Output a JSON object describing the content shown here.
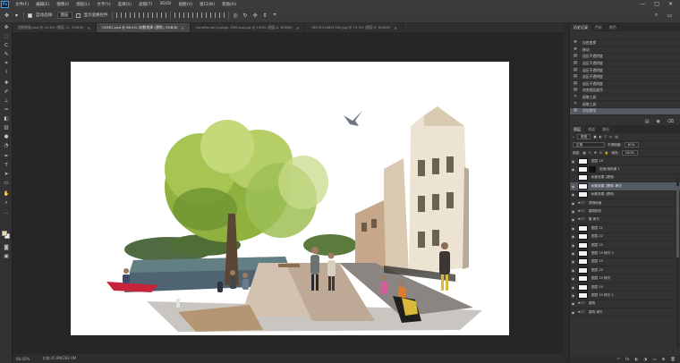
{
  "menubar": {
    "logo": "Ps",
    "items": [
      "文件(F)",
      "编辑(E)",
      "图像(I)",
      "图层(L)",
      "文字(Y)",
      "选择(S)",
      "滤镜(T)",
      "3D(D)",
      "视图(V)",
      "窗口(W)",
      "帮助(H)"
    ],
    "controls": [
      "—",
      "□",
      "✕"
    ]
  },
  "options": {
    "auto_select": "自动选择:",
    "target": "图层",
    "show_transform": "显示变换控件"
  },
  "tabs": [
    {
      "label": "透视拼贴.psd @ 20.6% (图层 12, RGB/8)",
      "active": false
    },
    {
      "label": "OVER1.psd @ 66.4% (树影效果 (透明), RGB/8)",
      "active": true
    },
    {
      "label": "LaneNursery.Lodge.-PMS-bar.jpg @ 100% (图层 0, RGB/8)",
      "active": false
    },
    {
      "label": "76078314851765.jpg @ 71.3% (图层 0, RGB/8)",
      "active": false
    }
  ],
  "status": {
    "zoom": "66.42%",
    "doc": "文档:45.8M/282.6M"
  },
  "history": {
    "tabs": [
      "历史记录",
      "色板",
      "颜色"
    ],
    "items": [
      {
        "icon": "✥",
        "label": "自由变换"
      },
      {
        "icon": "✥",
        "label": "移动"
      },
      {
        "icon": "▤",
        "label": "选区不透明度"
      },
      {
        "icon": "▤",
        "label": "选区不透明度"
      },
      {
        "icon": "▤",
        "label": "选区不透明度"
      },
      {
        "icon": "▤",
        "label": "选区不透明度"
      },
      {
        "icon": "▤",
        "label": "选区不透明度"
      },
      {
        "icon": "▤",
        "label": "改变图层顺序"
      },
      {
        "icon": "✎",
        "label": "画笔工具"
      },
      {
        "icon": "✎",
        "label": "画笔工具"
      },
      {
        "icon": "▤",
        "label": "添加蒙版"
      }
    ]
  },
  "layers": {
    "tabs": [
      "图层",
      "通道",
      "路径"
    ],
    "kind": "类型",
    "blend": "正常",
    "opacity_label": "不透明度:",
    "opacity": "61%",
    "lock_label": "锁定:",
    "fill_label": "填充:",
    "fill": "100%",
    "rows": [
      {
        "type": "layer",
        "name": "图层 18",
        "visible": true,
        "selected": false
      },
      {
        "type": "mask",
        "name": "色相/饱和度 1",
        "visible": true,
        "selected": false
      },
      {
        "type": "layer",
        "name": "树影效果 (透明)",
        "visible": false,
        "selected": false
      },
      {
        "type": "layer",
        "name": "树影效果 (透明) 拷贝",
        "visible": true,
        "selected": true
      },
      {
        "type": "layer",
        "name": "树影效果 (透明)",
        "visible": true,
        "selected": false
      },
      {
        "type": "folder",
        "name": "透视地面",
        "visible": true,
        "selected": false
      },
      {
        "type": "folder",
        "name": "建筑配件",
        "visible": true,
        "selected": false
      },
      {
        "type": "folder",
        "name": "集 拷贝",
        "visible": true,
        "selected": false
      },
      {
        "type": "layer",
        "name": "图层 21",
        "visible": true,
        "selected": false
      },
      {
        "type": "layer",
        "name": "图层 22",
        "visible": true,
        "selected": false
      },
      {
        "type": "layer",
        "name": "图层 23",
        "visible": true,
        "selected": false
      },
      {
        "type": "layer",
        "name": "图层 19 拷贝 3",
        "visible": true,
        "selected": false
      },
      {
        "type": "layer",
        "name": "图层 19",
        "visible": true,
        "selected": false
      },
      {
        "type": "layer",
        "name": "图层 20",
        "visible": true,
        "selected": false
      },
      {
        "type": "layer",
        "name": "图层 19 拷贝",
        "visible": true,
        "selected": false
      },
      {
        "type": "layer",
        "name": "图层 24",
        "visible": true,
        "selected": false
      },
      {
        "type": "layer",
        "name": "图层 19 拷贝 2",
        "visible": true,
        "selected": false
      },
      {
        "type": "folder",
        "name": "建筑",
        "visible": true,
        "selected": false
      },
      {
        "type": "folder",
        "name": "建筑 拷贝",
        "visible": true,
        "selected": false
      }
    ],
    "footer": [
      "ᶜᵒ",
      "fx",
      "◐",
      "◑",
      "▭",
      "⊞",
      "🗑"
    ]
  },
  "colors": {
    "accent": "#31a8ff",
    "foreground": "#e9dba8",
    "background": "#f4f4f4"
  }
}
